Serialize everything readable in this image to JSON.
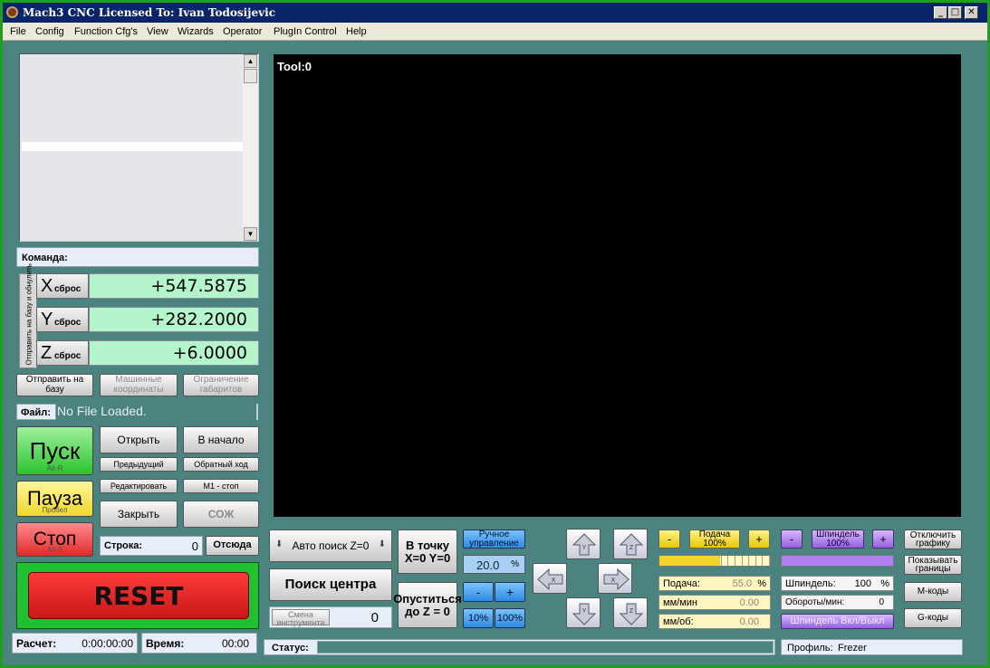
{
  "window": {
    "title": "Mach3 CNC  Licensed To: Ivan Todosijevic",
    "min": "_",
    "max": "□",
    "close": "✕"
  },
  "menu": [
    "File",
    "Config",
    "Function Cfg's",
    "View",
    "Wizards",
    "Operator",
    "PlugIn Control",
    "Help"
  ],
  "command": {
    "label": "Команда:"
  },
  "dro": {
    "side_label": "Отправить на базу и обнулить",
    "reset_label": "сброс",
    "axes": [
      {
        "letter": "X",
        "value": "+547.5875"
      },
      {
        "letter": "Y",
        "value": "+282.2000"
      },
      {
        "letter": "Z",
        "value": "+6.0000"
      }
    ]
  },
  "buttons": {
    "ref_all": "Отправить на базу",
    "machine_coords": "Машинные координаты",
    "soft_limits": "Ограничение габаритов",
    "open": "Открыть",
    "rewind": "В начало",
    "prev": "Предыдущий",
    "reverse": "Обратный ход",
    "edit": "Редактировать",
    "m1": "М1 - стоп",
    "close": "Закрыть",
    "coolant": "СОЖ",
    "run": "Пуск",
    "run_hotkey": "Alt-R",
    "pause": "Пауза",
    "pause_hotkey": "Пробел",
    "stop": "Стоп",
    "stop_hotkey": "Alt-S",
    "reset": "RESET",
    "from_here": "Отсюда",
    "auto_z": "Авто поиск Z=0",
    "goto_zero": "В точку X=0 Y=0",
    "find_center": "Поиск центра",
    "lower_z": "Опуститься до Z = 0",
    "tool_change": "Смена инструмента",
    "manual_control": "Ручное управление",
    "minus": "-",
    "plus": "+",
    "pct10": "10%",
    "pct100": "100%",
    "feed_btn": "Подача 100%",
    "spindle_btn": "Шпиндель 100%",
    "spindle_onoff": "Шпиндель Вкл/Выкл",
    "disable_graph": "Отключить графику",
    "show_limits": "Показывать границы",
    "m_codes": "М-коды",
    "g_codes": "G-коды"
  },
  "file": {
    "label": "Файл:",
    "value": "No File Loaded."
  },
  "line": {
    "label": "Строка:",
    "value": "0"
  },
  "calc": {
    "label": "Расчет:",
    "value": "0:00:00:00"
  },
  "time": {
    "label": "Время:",
    "value": "00:00"
  },
  "toolpath": {
    "label": "Tool:0"
  },
  "tool_value": "0",
  "jog_rate": {
    "value": "20.0",
    "unit": "%"
  },
  "feed": {
    "label": "Подача:",
    "value": "55.0",
    "unit": "%",
    "mm_min_label": "мм/мин",
    "mm_min": "0.00",
    "mm_rev_label": "мм/об:",
    "mm_rev": "0.00"
  },
  "spindle": {
    "label": "Шпиндель:",
    "value": "100",
    "unit": "%",
    "rpm_label": "Обороты/мин:",
    "rpm": "0"
  },
  "status": {
    "label": "Статус:",
    "value": ""
  },
  "profile": {
    "label": "Профиль:",
    "value": "Frezer"
  },
  "colors": {
    "run": "#36c83a",
    "pause": "#f2e23a",
    "stop": "#e83a3a",
    "reset": "#d02020",
    "reset_frame": "#20c030",
    "dro": "#b4f5cc"
  }
}
